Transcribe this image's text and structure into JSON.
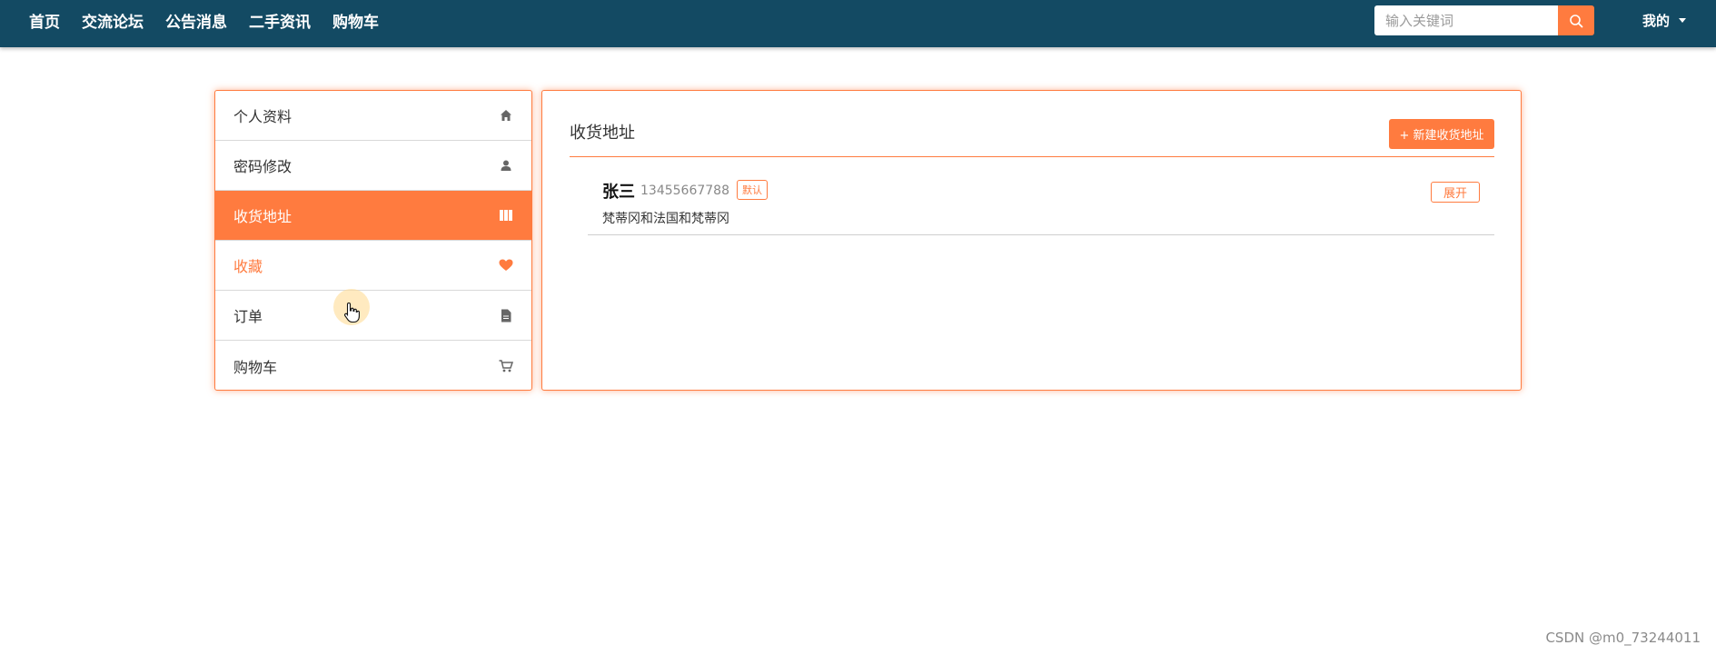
{
  "nav": {
    "items": [
      "首页",
      "交流论坛",
      "公告消息",
      "二手资讯",
      "购物车"
    ]
  },
  "search": {
    "placeholder": "输入关键词",
    "value": ""
  },
  "user_menu": {
    "label": "我的"
  },
  "sidebar": {
    "items": [
      {
        "label": "个人资料",
        "icon": "home-icon",
        "state": "normal"
      },
      {
        "label": "密码修改",
        "icon": "user-icon",
        "state": "normal"
      },
      {
        "label": "收货地址",
        "icon": "map-icon",
        "state": "active"
      },
      {
        "label": "收藏",
        "icon": "heart-icon",
        "state": "hover"
      },
      {
        "label": "订单",
        "icon": "file-icon",
        "state": "normal"
      },
      {
        "label": "购物车",
        "icon": "cart-icon",
        "state": "normal"
      }
    ]
  },
  "main": {
    "title": "收货地址",
    "new_button": "+ 新建收货地址",
    "addresses": [
      {
        "name": "张三",
        "phone": "13455667788",
        "badge": "默认",
        "detail": "梵蒂冈和法国和梵蒂冈",
        "expand_label": "展开"
      }
    ]
  },
  "watermark": "CSDN @m0_73244011",
  "colors": {
    "topbar": "#134a63",
    "accent": "#ff7b3f"
  }
}
